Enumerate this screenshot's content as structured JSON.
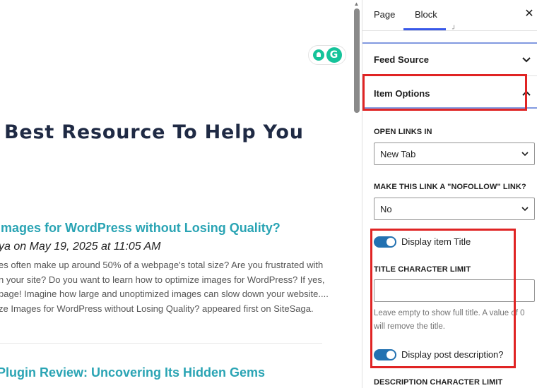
{
  "canvas": {
    "heading": "Best Resource To Help You",
    "posts": [
      {
        "title": "Images for WordPress without Losing Quality?",
        "meta": "ya on May 19, 2025 at 11:05 AM",
        "excerpt": [
          "es often make up around 50% of a webpage's total size?  Are you frustrated with",
          "n your site? Do you want to learn how to optimize images for WordPress? If yes,",
          "page! Imagine how large and unoptimized images can slow down your website....",
          "ze Images for WordPress without Losing Quality? appeared first on SiteSaga."
        ]
      },
      {
        "title": "Plugin Review: Uncovering Its Hidden Gems"
      }
    ]
  },
  "sidebar": {
    "tabs": [
      "Page",
      "Block"
    ],
    "active_tab": "Block",
    "close_icon": "close-icon",
    "panels": {
      "feed_source": "Feed Source",
      "item_options": "Item Options"
    },
    "open_links": {
      "label": "OPEN LINKS IN",
      "value": "New Tab"
    },
    "nofollow": {
      "label": "MAKE THIS LINK A \"NOFOLLOW\" LINK?",
      "value": "No"
    },
    "display_title": {
      "label": "Display item Title",
      "enabled": true
    },
    "title_limit": {
      "label": "TITLE CHARACTER LIMIT",
      "value": "",
      "help": "Leave empty to show full title. A value of 0 will remove the title."
    },
    "display_desc": {
      "label": "Display post description?",
      "enabled": true
    },
    "desc_limit": {
      "label": "DESCRIPTION CHARACTER LIMIT"
    }
  },
  "colors": {
    "accent": "#3858e9",
    "toggle_on": "#2271b1",
    "link": "#2aa4b4",
    "highlight": "#e02424"
  }
}
